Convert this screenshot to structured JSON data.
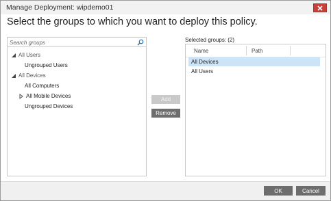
{
  "window": {
    "title": "Manage Deployment: wipdemo01",
    "close_icon": "close-icon",
    "heading": "Select the groups to which you want to deploy this policy."
  },
  "groups_tree": {
    "search_placeholder": "Search groups",
    "search_icon": "search-icon",
    "items": [
      {
        "label": "All Users",
        "expander": "expanded",
        "muted": true
      },
      {
        "label": "Ungrouped Users",
        "expander": "none",
        "muted": false
      },
      {
        "label": "All Devices",
        "expander": "expanded",
        "muted": true
      },
      {
        "label": "All Computers",
        "expander": "none",
        "muted": false
      },
      {
        "label": "All Mobile Devices",
        "expander": "collapsed",
        "muted": false
      },
      {
        "label": "Ungrouped Devices",
        "expander": "none",
        "muted": false
      }
    ]
  },
  "actions": {
    "add_label": "Add",
    "add_enabled": false,
    "remove_label": "Remove"
  },
  "selected_groups": {
    "label": "Selected groups: (2)",
    "columns": [
      "Name",
      "Path"
    ],
    "rows": [
      {
        "name": "All Devices",
        "path": "",
        "selected": true
      },
      {
        "name": "All Users",
        "path": "",
        "selected": false
      }
    ]
  },
  "footer": {
    "ok_label": "OK",
    "cancel_label": "Cancel"
  },
  "colors": {
    "close_button": "#c7413a",
    "selection_highlight": "#cce4f7",
    "primary_button": "#6d6d6d",
    "disabled_button": "#c9c9c9"
  }
}
